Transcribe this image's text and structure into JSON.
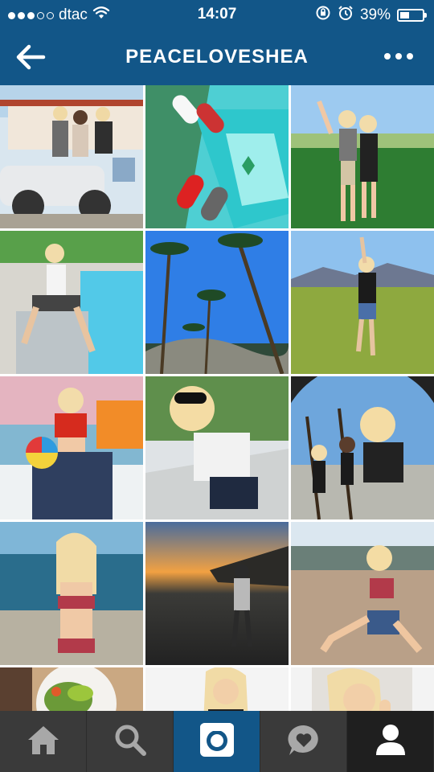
{
  "status_bar": {
    "carrier": "dtac",
    "signal_strength": "3 of 5",
    "wifi_icon": "wifi-icon",
    "time": "14:07",
    "battery_percent": "39%",
    "battery_level": 0.39
  },
  "header": {
    "title": "PEACELOVESHEA",
    "back_icon": "arrow-left-icon",
    "more_icon": "more-dots-icon"
  },
  "grid": {
    "columns": 3,
    "tiles": [
      {
        "id": "photo-1",
        "desc": "three friends on vintage car"
      },
      {
        "id": "photo-2",
        "desc": "flip flops by pool"
      },
      {
        "id": "photo-3",
        "desc": "two friends at festival"
      },
      {
        "id": "photo-4",
        "desc": "woman sitting by pool"
      },
      {
        "id": "photo-5",
        "desc": "palm trees and blue sky"
      },
      {
        "id": "photo-6",
        "desc": "woman in field"
      },
      {
        "id": "photo-7",
        "desc": "woman with beach ball"
      },
      {
        "id": "photo-8",
        "desc": "selfie with sunglasses"
      },
      {
        "id": "photo-9",
        "desc": "fisheye group photo"
      },
      {
        "id": "photo-10",
        "desc": "woman in bikini at sea"
      },
      {
        "id": "photo-11",
        "desc": "sunset at beach"
      },
      {
        "id": "photo-12",
        "desc": "woman sitting on sand"
      },
      {
        "id": "photo-13",
        "desc": "salad plate"
      },
      {
        "id": "photo-14",
        "desc": "portrait in white"
      },
      {
        "id": "photo-15",
        "desc": "portrait with hand"
      }
    ]
  },
  "tab_bar": {
    "tabs": [
      {
        "icon": "home-icon",
        "active": false
      },
      {
        "icon": "search-icon",
        "active": false
      },
      {
        "icon": "camera-icon",
        "active": true
      },
      {
        "icon": "heart-bubble-icon",
        "active": false
      },
      {
        "icon": "profile-icon",
        "active": false
      }
    ]
  },
  "colors": {
    "brand": "#125688",
    "tab_bar": "#3a3a3a",
    "tab_active": "#125688",
    "tab_profile": "#1f1f1f"
  }
}
